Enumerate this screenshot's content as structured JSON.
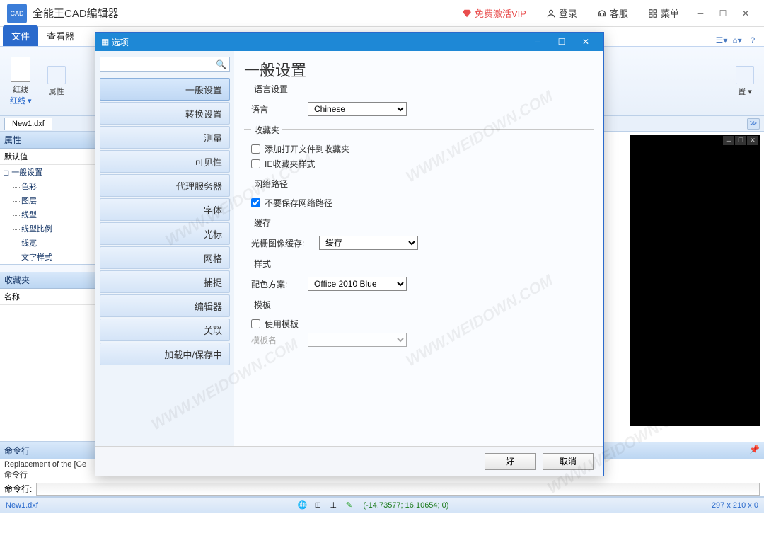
{
  "app": {
    "logo_text": "CAD",
    "title": "全能王CAD编辑器"
  },
  "header_links": {
    "vip": "免费激活VIP",
    "login": "登录",
    "support": "客服",
    "menu": "菜单"
  },
  "ribbon": {
    "tabs": [
      "文件",
      "查看器"
    ],
    "group1_label": "红线",
    "group1_sub": "红线",
    "group2_label": "属性",
    "far_label": "置"
  },
  "doc_tabs": {
    "active": "New1.dxf"
  },
  "panels": {
    "props_title": "属性",
    "props_default": "默认值",
    "tree_root": "一般设置",
    "tree_items": [
      "色彩",
      "图层",
      "线型",
      "线型比例",
      "线宽",
      "文字样式"
    ],
    "fav_title": "收藏夹",
    "fav_col": "名称"
  },
  "cmd": {
    "title": "命令行",
    "log1": "Replacement of the [Ge",
    "log2": "命令行",
    "prompt": "命令行:"
  },
  "status": {
    "file": "New1.dxf",
    "coords": "(-14.73577; 16.10654; 0)",
    "dims": "297 x 210 x 0"
  },
  "dialog": {
    "title": "选项",
    "search_placeholder": "",
    "nav": [
      "一般设置",
      "转换设置",
      "测量",
      "可见性",
      "代理服务器",
      "字体",
      "光标",
      "网格",
      "捕捉",
      "编辑器",
      "关联",
      "加载中/保存中"
    ],
    "heading": "一般设置",
    "lang": {
      "legend": "语言设置",
      "label": "语言",
      "value": "Chinese"
    },
    "fav": {
      "legend": "收藏夹",
      "opt1": "添加打开文件到收藏夹",
      "opt2": "IE收藏夹样式"
    },
    "net": {
      "legend": "网络路径",
      "opt1": "不要保存网络路径"
    },
    "cache": {
      "legend": "缓存",
      "label": "光栅图像缓存:",
      "value": "缓存"
    },
    "style": {
      "legend": "样式",
      "label": "配色方案:",
      "value": "Office 2010 Blue"
    },
    "tmpl": {
      "legend": "模板",
      "opt1": "使用模板",
      "label": "模板名"
    },
    "ok": "好",
    "cancel": "取消"
  }
}
